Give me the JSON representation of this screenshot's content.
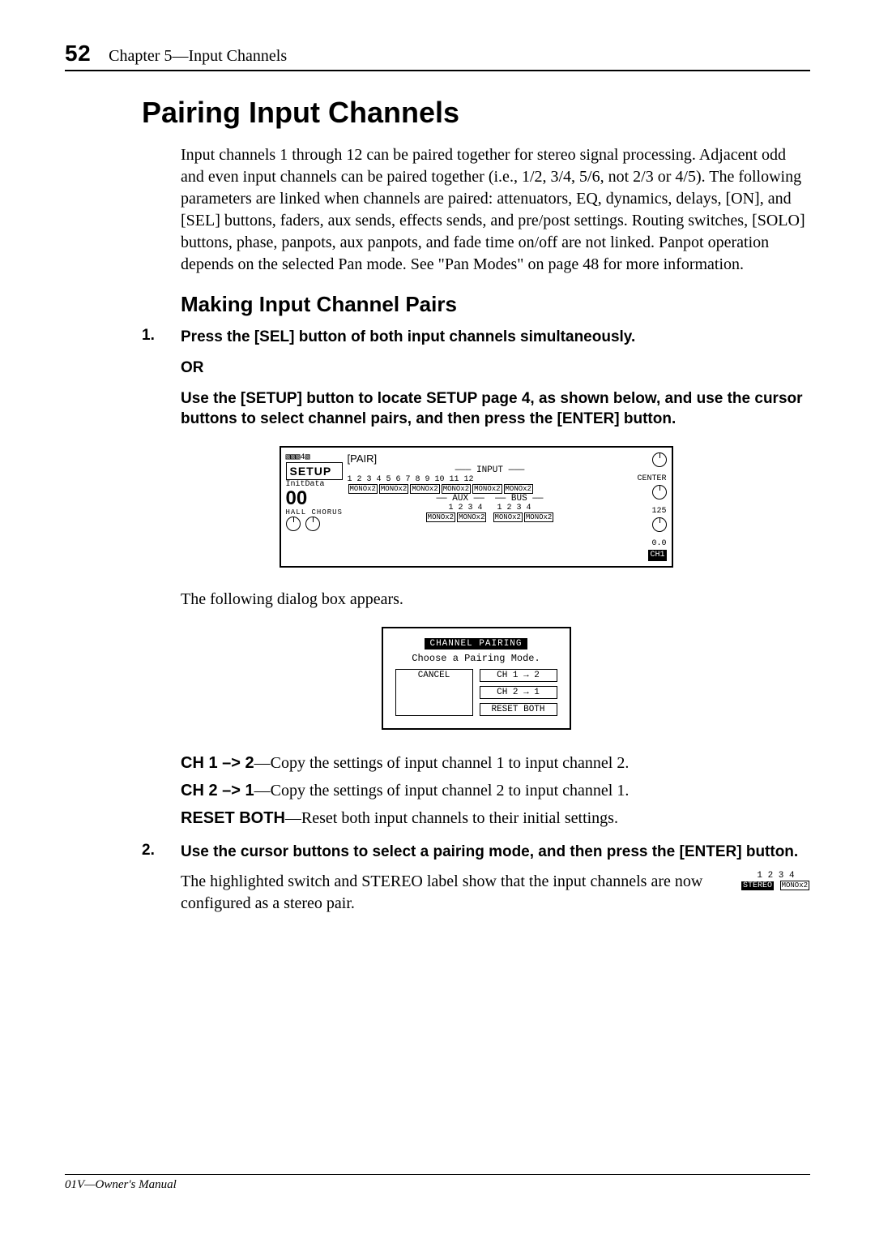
{
  "page": {
    "number": "52",
    "chapter_line": "Chapter 5—Input Channels",
    "footer": "01V—Owner's Manual"
  },
  "section": {
    "title": "Pairing Input Channels",
    "intro": "Input channels 1 through 12 can be paired together for stereo signal processing. Adjacent odd and even input channels can be paired together (i.e., 1/2, 3/4, 5/6, not 2/3 or 4/5). The following parameters are linked when channels are paired: attenuators, EQ, dynamics, delays, [ON], and [SEL] buttons, faders, aux sends, effects sends, and pre/post settings. Routing switches, [SOLO] buttons, phase, panpots, aux panpots, and fade time on/off are not linked. Panpot operation depends on the selected Pan mode. See \"Pan Modes\" on page 48 for more information."
  },
  "subsection": {
    "title": "Making Input Channel Pairs",
    "step1_num": "1.",
    "step1": "Press the [SEL] button of both input channels simultaneously.",
    "or": "OR",
    "step1b": "Use the [SETUP] button to locate SETUP page 4, as shown below, and use the cursor buttons to select channel pairs, and then press the [ENTER] button.",
    "after_fig1": "The following dialog box appears.",
    "defs": {
      "d1_key": "CH 1 –> 2",
      "d1_txt": "—Copy the settings of input channel 1 to input channel 2.",
      "d2_key": "CH 2 –> 1",
      "d2_txt": "—Copy the settings of input channel 2 to input channel 1.",
      "d3_key": "RESET BOTH",
      "d3_txt": "—Reset both input channels to their initial settings."
    },
    "step2_num": "2.",
    "step2": "Use the cursor buttons to select a pairing mode, and then press the [ENTER] button.",
    "after_step2": "The highlighted switch and STEREO label show that the input channels are now configured as a stereo pair."
  },
  "fig1": {
    "setup": "SETUP",
    "init": "InitData",
    "big00": "00",
    "hall": "HALL",
    "chorus": "CHORUS",
    "pair_tag": "[PAIR]",
    "input_label": "INPUT",
    "input_nums": "1   2  3   4  5   6  7   8  9   10 11   12",
    "center": "CENTER",
    "mono": "MONOx2",
    "aux": "AUX",
    "bus": "BUS",
    "aux_nums": "1   2  3   4",
    "bus_nums": "1   2  3   4",
    "val125": "125",
    "val00": "0.0",
    "ch1": "CH1"
  },
  "fig2": {
    "title": "CHANNEL PAIRING",
    "prompt": "Choose a Pairing Mode.",
    "cancel": "CANCEL",
    "ch12": "CH 1 → 2",
    "ch21": "CH 2 → 1",
    "reset": "RESET BOTH"
  },
  "thumb": {
    "nums": "1   2  3   4",
    "stereo": "STEREO",
    "mono": "MONOx2"
  }
}
